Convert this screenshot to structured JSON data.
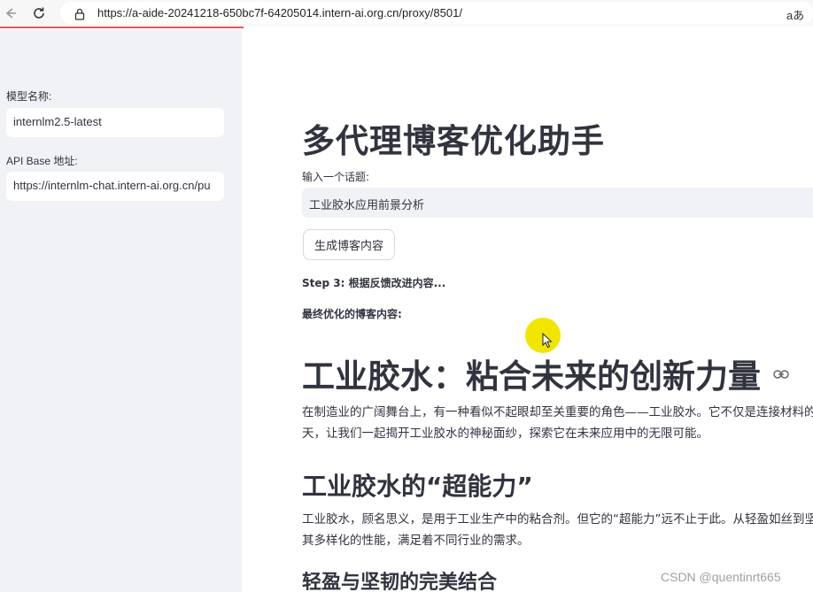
{
  "browser": {
    "url": "https://a-aide-20241218-650bc7f-64205014.intern-ai.org.cn/proxy/8501/",
    "reader_label": "aあ",
    "load_progress": 0.3
  },
  "sidebar": {
    "model_label": "模型名称:",
    "model_value": "internlm2.5-latest",
    "api_label": "API Base 地址:",
    "api_value": "https://internlm-chat.intern-ai.org.cn/pu"
  },
  "main": {
    "title": "多代理博客优化助手",
    "topic_label": "输入一个话题:",
    "topic_value": "工业胶水应用前景分析",
    "generate_button": "生成博客内容",
    "step_text": "Step 3: 根据反馈改进内容...",
    "final_label": "最终优化的博客内容:",
    "article": {
      "h1": "工业胶水：粘合未来的创新力量",
      "p1_line1": "在制造业的广阔舞台上，有一种看似不起眼却至关重要的角色——工业胶水。它不仅是连接材料的",
      "p1_line2": "天，让我们一起揭开工业胶水的神秘面纱，探索它在未来应用中的无限可能。",
      "h2": "工业胶水的“超能力”",
      "p2_line1": "工业胶水，顾名思义，是用于工业生产中的粘合剂。但它的“超能力”远不止于此。从轻盈如丝到坚",
      "p2_line2": "其多样化的性能，满足着不同行业的需求。",
      "h3": "轻盈与坚韧的完美结合"
    }
  },
  "watermark": "CSDN @quentinrt665",
  "colors": {
    "sidebar_bg": "#f0f2f6",
    "text": "#31333f",
    "cursor_highlight": "#f2e600",
    "progress": "#e05a5a"
  }
}
